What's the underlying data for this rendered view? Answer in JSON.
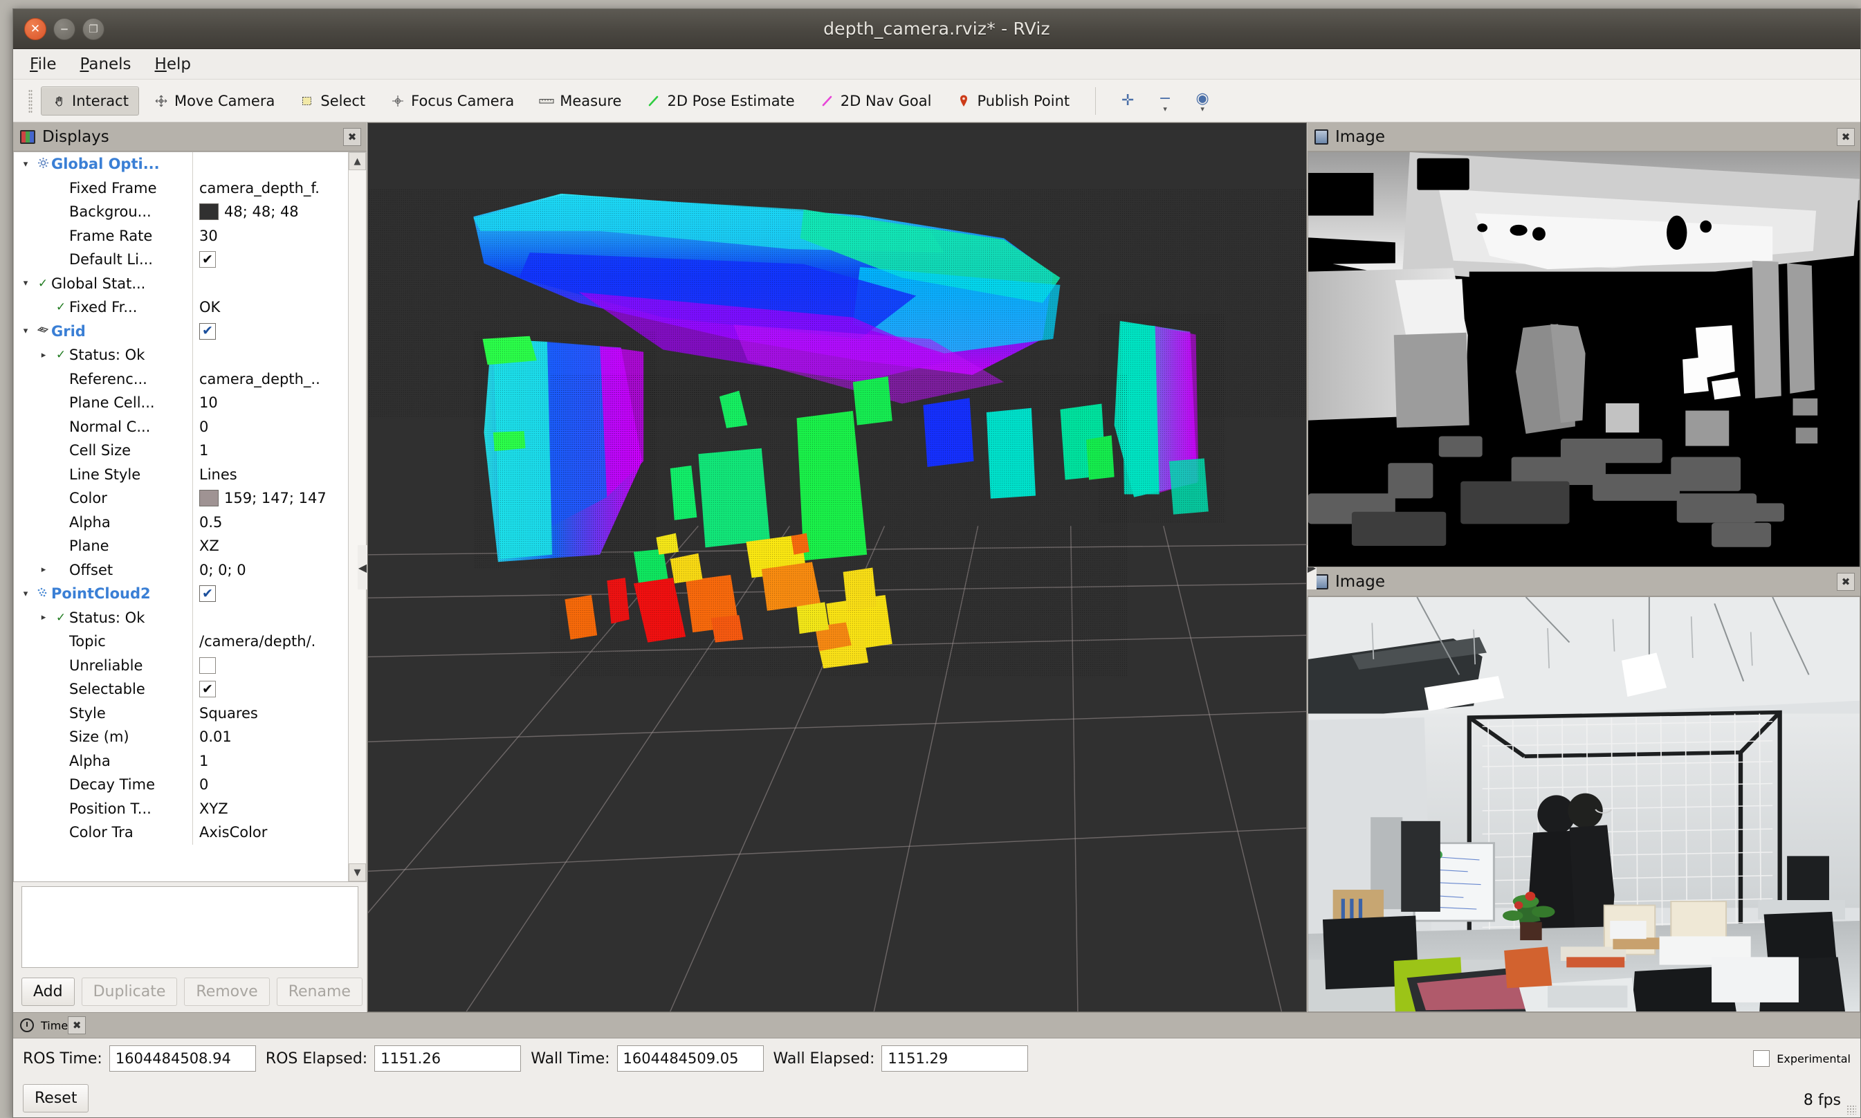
{
  "window": {
    "title": "depth_camera.rviz* - RViz",
    "close_icon": "close-icon",
    "minimize_icon": "minimize-icon",
    "maximize_icon": "maximize-icon"
  },
  "menubar": {
    "items": [
      "File",
      "Panels",
      "Help"
    ]
  },
  "toolbar": {
    "buttons": [
      {
        "label": "Interact",
        "icon": "hand-cursor-icon",
        "active": true,
        "glyph": "☚"
      },
      {
        "label": "Move Camera",
        "icon": "move-camera-icon",
        "active": false,
        "glyph": "✥"
      },
      {
        "label": "Select",
        "icon": "select-box-icon",
        "active": false,
        "glyph": "▢"
      },
      {
        "label": "Focus Camera",
        "icon": "focus-camera-icon",
        "active": false,
        "glyph": "✥"
      },
      {
        "label": "Measure",
        "icon": "ruler-icon",
        "active": false,
        "glyph": "▭"
      },
      {
        "label": "2D Pose Estimate",
        "icon": "pose-arrow-icon",
        "active": false,
        "glyph": "╱"
      },
      {
        "label": "2D Nav Goal",
        "icon": "nav-goal-arrow-icon",
        "active": false,
        "glyph": "╱"
      },
      {
        "label": "Publish Point",
        "icon": "map-pin-icon",
        "active": false,
        "glyph": "⚲"
      }
    ],
    "zoom_controls": [
      {
        "name": "add-tool-button",
        "glyph": "✛",
        "has_caret": false
      },
      {
        "name": "remove-tool-button",
        "glyph": "−",
        "has_caret": true
      },
      {
        "name": "tool-properties-button",
        "glyph": "◉",
        "has_caret": true
      }
    ]
  },
  "displays_panel": {
    "title": "Displays",
    "close_icon": "close-icon",
    "rows": [
      {
        "indent": 0,
        "twisty": "▾",
        "icon": "gear-icon",
        "name": "Global Opti...",
        "value_type": "none",
        "value": "",
        "bold": true
      },
      {
        "indent": 1,
        "twisty": "",
        "icon": "",
        "name": "Fixed Frame",
        "value_type": "text",
        "value": "camera_depth_f.",
        "bold": false
      },
      {
        "indent": 1,
        "twisty": "",
        "icon": "",
        "name": "Backgrou...",
        "value_type": "color",
        "value": "48; 48; 48",
        "color": "#303030",
        "bold": false
      },
      {
        "indent": 1,
        "twisty": "",
        "icon": "",
        "name": "Frame Rate",
        "value_type": "text",
        "value": "30",
        "bold": false
      },
      {
        "indent": 1,
        "twisty": "",
        "icon": "",
        "name": "Default Li...",
        "value_type": "checked",
        "value": "",
        "bold": false
      },
      {
        "indent": 0,
        "twisty": "▾",
        "icon": "check-icon",
        "name": "Global Stat...",
        "value_type": "none",
        "value": "",
        "bold": false
      },
      {
        "indent": 1,
        "twisty": "",
        "icon": "check-icon",
        "name": "Fixed Fr...",
        "value_type": "text",
        "value": "OK",
        "bold": false
      },
      {
        "indent": 0,
        "twisty": "▾",
        "icon": "grid-icon",
        "name": "Grid",
        "value_type": "checked-blue",
        "value": "",
        "bold": true
      },
      {
        "indent": 1,
        "twisty": "▸",
        "icon": "check-icon",
        "name": "Status: Ok",
        "value_type": "none",
        "value": "",
        "bold": false
      },
      {
        "indent": 1,
        "twisty": "",
        "icon": "",
        "name": "Referenc...",
        "value_type": "text",
        "value": "camera_depth_..",
        "bold": false
      },
      {
        "indent": 1,
        "twisty": "",
        "icon": "",
        "name": "Plane Cell...",
        "value_type": "text",
        "value": "10",
        "bold": false
      },
      {
        "indent": 1,
        "twisty": "",
        "icon": "",
        "name": "Normal C...",
        "value_type": "text",
        "value": "0",
        "bold": false
      },
      {
        "indent": 1,
        "twisty": "",
        "icon": "",
        "name": "Cell Size",
        "value_type": "text",
        "value": "1",
        "bold": false
      },
      {
        "indent": 1,
        "twisty": "",
        "icon": "",
        "name": "Line Style",
        "value_type": "text",
        "value": "Lines",
        "bold": false
      },
      {
        "indent": 1,
        "twisty": "",
        "icon": "",
        "name": "Color",
        "value_type": "color",
        "value": "159; 147; 147",
        "color": "#9f9393",
        "bold": false
      },
      {
        "indent": 1,
        "twisty": "",
        "icon": "",
        "name": "Alpha",
        "value_type": "text",
        "value": "0.5",
        "bold": false
      },
      {
        "indent": 1,
        "twisty": "",
        "icon": "",
        "name": "Plane",
        "value_type": "text",
        "value": "XZ",
        "bold": false
      },
      {
        "indent": 1,
        "twisty": "▸",
        "icon": "",
        "name": "Offset",
        "value_type": "text",
        "value": "0; 0; 0",
        "bold": false
      },
      {
        "indent": 0,
        "twisty": "▾",
        "icon": "pointcloud-icon",
        "name": "PointCloud2",
        "value_type": "checked-blue",
        "value": "",
        "bold": true
      },
      {
        "indent": 1,
        "twisty": "▸",
        "icon": "check-icon",
        "name": "Status: Ok",
        "value_type": "none",
        "value": "",
        "bold": false
      },
      {
        "indent": 1,
        "twisty": "",
        "icon": "",
        "name": "Topic",
        "value_type": "text",
        "value": "/camera/depth/.",
        "bold": false
      },
      {
        "indent": 1,
        "twisty": "",
        "icon": "",
        "name": "Unreliable",
        "value_type": "unchecked",
        "value": "",
        "bold": false
      },
      {
        "indent": 1,
        "twisty": "",
        "icon": "",
        "name": "Selectable",
        "value_type": "checked",
        "value": "",
        "bold": false
      },
      {
        "indent": 1,
        "twisty": "",
        "icon": "",
        "name": "Style",
        "value_type": "text",
        "value": "Squares",
        "bold": false
      },
      {
        "indent": 1,
        "twisty": "",
        "icon": "",
        "name": "Size (m)",
        "value_type": "text",
        "value": "0.01",
        "bold": false
      },
      {
        "indent": 1,
        "twisty": "",
        "icon": "",
        "name": "Alpha",
        "value_type": "text",
        "value": "1",
        "bold": false
      },
      {
        "indent": 1,
        "twisty": "",
        "icon": "",
        "name": "Decay Time",
        "value_type": "text",
        "value": "0",
        "bold": false
      },
      {
        "indent": 1,
        "twisty": "",
        "icon": "",
        "name": "Position T...",
        "value_type": "text",
        "value": "XYZ",
        "bold": false
      },
      {
        "indent": 1,
        "twisty": "",
        "icon": "",
        "name": "Color Tra",
        "value_type": "text",
        "value": "AxisColor",
        "bold": false
      }
    ],
    "buttons": [
      {
        "label": "Add",
        "enabled": true
      },
      {
        "label": "Duplicate",
        "enabled": false
      },
      {
        "label": "Remove",
        "enabled": false
      },
      {
        "label": "Rename",
        "enabled": false
      }
    ],
    "scroll_up_icon": "chevron-up-icon",
    "scroll_down_icon": "chevron-down-icon"
  },
  "viewport": {
    "name": "3d-render-view",
    "background_color": "#303030",
    "grid_color": "#9f9393",
    "collapse_left_icon": "chevron-left-icon",
    "collapse_right_icon": "chevron-right-icon"
  },
  "image_panels": [
    {
      "title": "Image",
      "kind": "depth",
      "close_icon": "close-icon"
    },
    {
      "title": "Image",
      "kind": "rgb",
      "close_icon": "close-icon"
    }
  ],
  "time_panel": {
    "title": "Time",
    "close_icon": "close-icon",
    "fields": [
      {
        "label": "ROS Time:",
        "value": "1604484508.94"
      },
      {
        "label": "ROS Elapsed:",
        "value": "1151.26"
      },
      {
        "label": "Wall Time:",
        "value": "1604484509.05"
      },
      {
        "label": "Wall Elapsed:",
        "value": "1151.29"
      }
    ],
    "reset_button": "Reset",
    "experimental_label": "Experimental",
    "experimental_checked": false,
    "fps": "8 fps"
  }
}
